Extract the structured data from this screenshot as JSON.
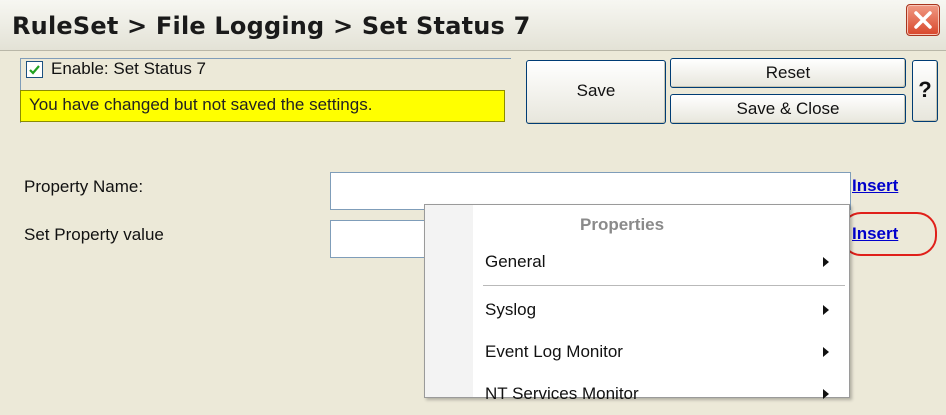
{
  "window": {
    "title": "RuleSet > File Logging > Set Status 7"
  },
  "enable": {
    "label": "Enable: Set Status 7",
    "checked": true
  },
  "warning": {
    "text": "You have changed but not saved the settings."
  },
  "toolbar": {
    "save_label": "Save",
    "reset_label": "Reset",
    "save_close_label": "Save & Close",
    "help_label": "?"
  },
  "form": {
    "property_name_label": "Property Name:",
    "property_name_value": "",
    "property_value_label": "Set Property value",
    "property_value_value": "",
    "insert_label": "Insert",
    "insert_label_2": "Insert"
  },
  "menu": {
    "header": "Properties",
    "items": [
      {
        "label": "General"
      },
      {
        "label": "Syslog"
      },
      {
        "label": "Event Log Monitor"
      },
      {
        "label": "NT Services Monitor"
      }
    ]
  },
  "colors": {
    "warning_bg": "#ffff00",
    "link": "#0000cc",
    "annotation": "#e0201a",
    "close_button": "#d8462b"
  },
  "icons": {
    "close": "close-icon",
    "check": "check-icon",
    "submenu": "chevron-right-icon",
    "annotation_arrow": "arrow-left-icon"
  }
}
